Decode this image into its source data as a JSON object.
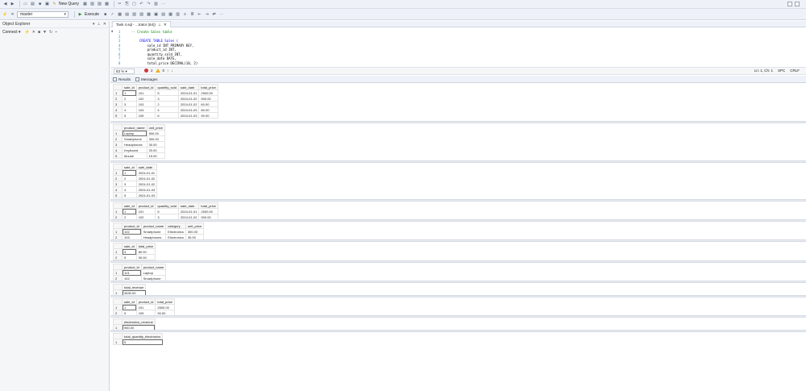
{
  "toolbar": {
    "new_query_label": "New Query",
    "database": "master",
    "execute_label": "Execute"
  },
  "object_explorer": {
    "title": "Object Explorer",
    "connect_label": "Connect"
  },
  "document_tab": {
    "title": "Task 4.sql - ...trator (64))"
  },
  "editor": {
    "lines": [
      {
        "num": "1",
        "text": "-- Create Sales table"
      },
      {
        "num": "2",
        "text": ""
      },
      {
        "num": "3",
        "text": "CREATE TABLE Sales ("
      },
      {
        "num": "4",
        "text": "    sale_id INT PRIMARY KEY,"
      },
      {
        "num": "5",
        "text": "    product_id INT,"
      },
      {
        "num": "6",
        "text": "    quantity_sold INT,"
      },
      {
        "num": "7",
        "text": "    sale_date DATE,"
      },
      {
        "num": "8",
        "text": "    total_price DECIMAL(10, 2)"
      }
    ]
  },
  "status": {
    "zoom": "83 %",
    "errors": "2",
    "warnings": "0",
    "position": "Ln: 1, Ch: 1",
    "spacing": "SPC",
    "line_ending": "CRLF"
  },
  "results_tabs": {
    "results_label": "Results",
    "messages_label": "Messages"
  },
  "grids": [
    {
      "columns": [
        "sale_id",
        "product_id",
        "quantity_sold",
        "sale_date",
        "total_price"
      ],
      "rows": [
        [
          "1",
          "1",
          "101",
          "5",
          "2024-01-01",
          "2500.00"
        ],
        [
          "2",
          "2",
          "102",
          "3",
          "2024-01-02",
          "900.00"
        ],
        [
          "3",
          "3",
          "103",
          "2",
          "2024-01-02",
          "60.00"
        ],
        [
          "4",
          "4",
          "104",
          "4",
          "2024-01-03",
          "80.00"
        ],
        [
          "5",
          "5",
          "105",
          "6",
          "2024-01-03",
          "90.00"
        ]
      ]
    },
    {
      "columns": [
        "product_name",
        "unit_price"
      ],
      "rows": [
        [
          "1",
          "Laptop",
          "500.00"
        ],
        [
          "2",
          "Smartphone",
          "300.00"
        ],
        [
          "3",
          "Headphones",
          "30.00"
        ],
        [
          "4",
          "Keyboard",
          "20.00"
        ],
        [
          "5",
          "Mouse",
          "15.00"
        ]
      ]
    },
    {
      "columns": [
        "sale_id",
        "sale_date"
      ],
      "rows": [
        [
          "1",
          "1",
          "2024-01-01"
        ],
        [
          "2",
          "2",
          "2024-01-02"
        ],
        [
          "3",
          "3",
          "2024-01-02"
        ],
        [
          "4",
          "4",
          "2024-01-03"
        ],
        [
          "5",
          "5",
          "2024-01-03"
        ]
      ]
    },
    {
      "columns": [
        "sale_id",
        "product_id",
        "quantity_sold",
        "sale_date",
        "total_price"
      ],
      "rows": [
        [
          "1",
          "1",
          "101",
          "5",
          "2024-01-01",
          "2500.00"
        ],
        [
          "2",
          "2",
          "102",
          "3",
          "2024-01-02",
          "900.00"
        ]
      ]
    },
    {
      "columns": [
        "product_id",
        "product_name",
        "category",
        "unit_price"
      ],
      "rows": [
        [
          "1",
          "102",
          "Smartphone",
          "Electronics",
          "300.00"
        ],
        [
          "2",
          "103",
          "Headphones",
          "Electronics",
          "30.00"
        ]
      ]
    },
    {
      "columns": [
        "sale_id",
        "total_price"
      ],
      "rows": [
        [
          "1",
          "4",
          "80.00"
        ],
        [
          "2",
          "5",
          "90.00"
        ]
      ]
    },
    {
      "columns": [
        "product_id",
        "product_name"
      ],
      "rows": [
        [
          "1",
          "101",
          "Laptop"
        ],
        [
          "2",
          "102",
          "Smartphone"
        ]
      ]
    },
    {
      "columns": [
        "total_revenue"
      ],
      "rows": [
        [
          "1",
          "3630.00"
        ]
      ]
    },
    {
      "columns": [
        "sale_id",
        "product_id",
        "total_price"
      ],
      "rows": [
        [
          "1",
          "1",
          "101",
          "2500.00"
        ],
        [
          "2",
          "5",
          "105",
          "90.00"
        ]
      ]
    },
    {
      "columns": [
        "electronics_revenue"
      ],
      "rows": [
        [
          "1",
          "960.00"
        ]
      ]
    },
    {
      "columns": [
        "total_quantity_electronics"
      ],
      "rows": [
        [
          "1",
          "5"
        ]
      ]
    }
  ]
}
